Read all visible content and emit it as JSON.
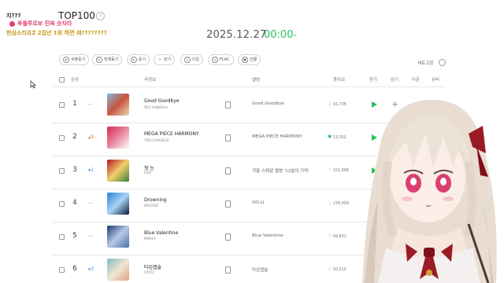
{
  "overlay": {
    "line1": "지???",
    "line2": "후플루르보 진짜 숫자라",
    "line3": "헌심소리죠Z 2집년 1위 하면 레????????"
  },
  "header": {
    "title": "TOP100",
    "help_icon": "question-mark-icon",
    "date": "2025.12.27",
    "time": "00:00"
  },
  "toolbar": {
    "buttons": [
      {
        "label": "셔플듣기",
        "icon": "shuffle-icon"
      },
      {
        "label": "전체듣기",
        "icon": "play-all-icon"
      },
      {
        "label": "듣기",
        "icon": "play-icon"
      },
      {
        "label": "담기",
        "icon": "plus-icon"
      },
      {
        "label": "다운",
        "icon": "download-icon"
      },
      {
        "label": "FLAC",
        "icon": "download-icon"
      },
      {
        "label": "선물",
        "icon": "gift-icon"
      }
    ],
    "refresh_label": "새로고침"
  },
  "table": {
    "headers": {
      "rank": "순위",
      "info": "곡정보",
      "album": "앨범",
      "likes": "좋아요",
      "listen": "듣기",
      "add": "담기",
      "download": "다운",
      "video": "뮤비"
    },
    "rows": [
      {
        "rank": "1",
        "change": "—",
        "change_type": "same",
        "title": "Good Goodbye",
        "artist": "화사 (HWASA)",
        "album": "Good Goodbye",
        "likes": "91,738",
        "liked": false,
        "art_colors": [
          "#7fb6d6",
          "#e8d9b8",
          "#c8553d"
        ]
      },
      {
        "rank": "2",
        "change": "9",
        "change_type": "up",
        "title": "MEGA PIECE HARMONY",
        "artist": "하데스(HADES)",
        "album": "MEGA PIECE HARMONY",
        "likes": "13,302",
        "liked": true,
        "art_colors": [
          "#d42a55",
          "#ffffff",
          "#e98aa0"
        ]
      },
      {
        "rank": "3",
        "change": "1",
        "change_type": "down",
        "title": "첫 눈",
        "artist": "EXO",
        "album": "겨울 스페셜 앨범 '12월의 기적'",
        "likes": "321,898",
        "liked": false,
        "art_colors": [
          "#b0142a",
          "#3a7d3a",
          "#f2d06b"
        ]
      },
      {
        "rank": "4",
        "change": "—",
        "change_type": "same",
        "title": "Drowning",
        "artist": "WOODZ",
        "album": "OO-LI",
        "likes": "276,409",
        "liked": false,
        "art_colors": [
          "#2a7fd6",
          "#0d1a3a",
          "#a9d4f5"
        ]
      },
      {
        "rank": "5",
        "change": "—",
        "change_type": "same",
        "title": "Blue Valentine",
        "artist": "NMIXX",
        "album": "Blue Valentine",
        "likes": "99,831",
        "liked": false,
        "art_colors": [
          "#1f3b6e",
          "#4e6fa8",
          "#b7c9e6"
        ]
      },
      {
        "rank": "6",
        "change": "3",
        "change_type": "down",
        "title": "타임캡슐",
        "artist": "다비치",
        "album": "타임캡슐",
        "likes": "50,310",
        "liked": false,
        "art_colors": [
          "#7fb7c9",
          "#d9a78a",
          "#f0e6d0"
        ]
      }
    ]
  },
  "colors": {
    "accent_green": "#27c15a",
    "up_orange": "#f07a1a",
    "down_blue": "#3a8de0"
  }
}
